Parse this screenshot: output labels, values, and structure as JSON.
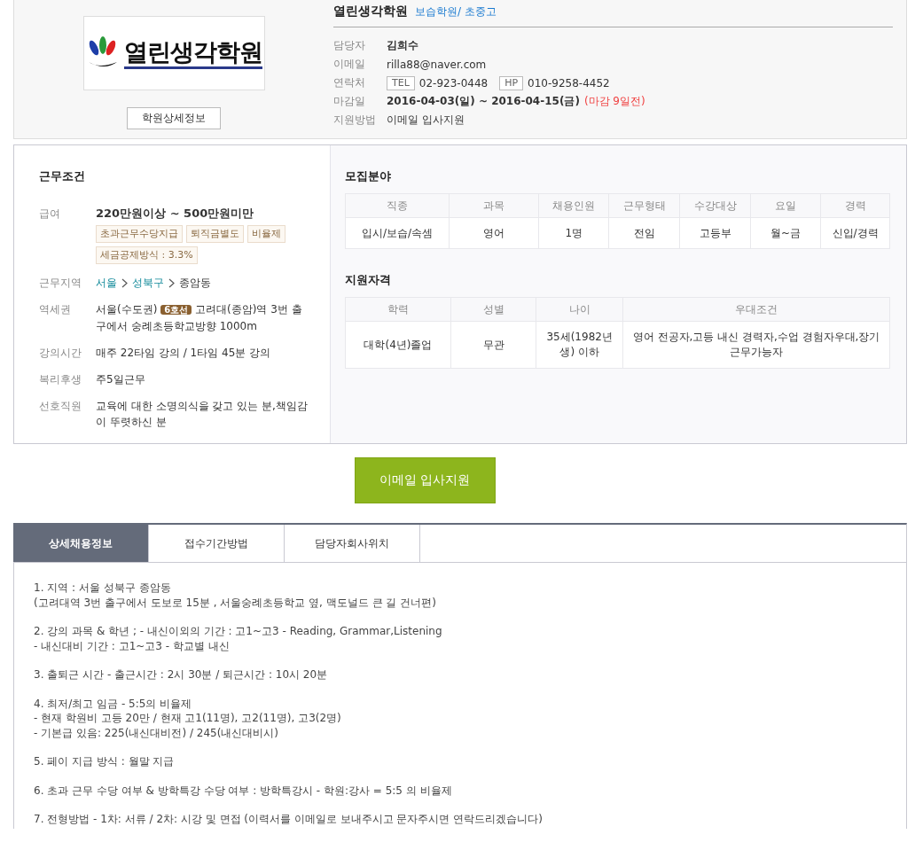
{
  "academy": {
    "logo_text": "열린생각학원",
    "detail_button": "학원상세정보",
    "name": "열린생각학원",
    "category": "보습학원/ 초중고"
  },
  "contact_rows": [
    {
      "label": "담당자",
      "kind": "bold",
      "value": "김희수"
    },
    {
      "label": "이메일",
      "kind": "plain",
      "value": "rilla88@naver.com"
    },
    {
      "label": "연락처",
      "kind": "phones",
      "phones": [
        {
          "tag": "TEL",
          "number": "02-923-0448"
        },
        {
          "tag": "HP",
          "number": "010-9258-4452"
        }
      ]
    },
    {
      "label": "마감일",
      "kind": "deadline",
      "value": "2016-04-03(일) ~ 2016-04-15(금)",
      "note": "(마감 9일전)"
    },
    {
      "label": "지원방법",
      "kind": "plain",
      "value": "이메일 입사지원"
    }
  ],
  "conditions": {
    "title": "근무조건",
    "rows": [
      {
        "label": "급여",
        "kind": "salary",
        "value": "220만원이상 ~ 500만원미만",
        "tags": [
          "초과근무수당지급",
          "퇴직금별도",
          "비율제",
          "세금공제방식 : 3.3%"
        ]
      },
      {
        "label": "근무지역",
        "kind": "location",
        "parts": [
          {
            "text": "서울",
            "link": true
          },
          {
            "text": "성북구",
            "link": true
          },
          {
            "text": "종암동",
            "link": false
          }
        ]
      },
      {
        "label": "역세권",
        "kind": "station",
        "region": "서울(수도권)",
        "line": "6호선",
        "text": "고려대(종암)역 3번 출구에서 숭례초등학교방향 1000m"
      },
      {
        "label": "강의시간",
        "kind": "plain",
        "value": "매주 22타임 강의 / 1타임 45분 강의"
      },
      {
        "label": "복리후생",
        "kind": "plain",
        "value": "주5일근무"
      },
      {
        "label": "선호직원",
        "kind": "plain",
        "value": "교육에 대한 소명의식을 갖고 있는 분,책임감이 뚜렷하신 분"
      }
    ]
  },
  "recruitment": {
    "title": "모집분야",
    "columns": [
      "직종",
      "과목",
      "채용인원",
      "근무형태",
      "수강대상",
      "요일",
      "경력"
    ],
    "rows": [
      [
        "입시/보습/속셈",
        "영어",
        "1명",
        "전임",
        "고등부",
        "월~금",
        "신입/경력"
      ]
    ]
  },
  "qualification": {
    "title": "지원자격",
    "columns": [
      "학력",
      "성별",
      "나이",
      "우대조건"
    ],
    "rows": [
      [
        "대학(4년)졸업",
        "무관",
        "35세(1982년생) 이하",
        "영어 전공자,고등 내신 경력자,수업 경험자우대,장기 근무가능자"
      ]
    ]
  },
  "apply_button": "이메일 입사지원",
  "tabs": [
    {
      "label": "상세채용정보",
      "selected": true
    },
    {
      "label": "접수기간방법",
      "selected": false
    },
    {
      "label": "담당자회사위치",
      "selected": false
    }
  ],
  "detail_paragraphs": [
    "1. 지역 : 서울 성북구 종암동\n(고려대역 3번 출구에서 도보로 15분 , 서울숭례초등학교 옆, 맥도널드 큰 길 건너편)",
    "2. 강의 과목 & 학년 ; - 내신이외의 기간 : 고1~고3 - Reading, Grammar,Listening\n- 내신대비 기간 : 고1~고3 - 학교별 내신",
    "3. 출퇴근 시간 - 출근시간 : 2시 30분 / 퇴근시간 : 10시 20분",
    "4. 최저/최고 임금 - 5:5의 비율제\n- 현재 학원비 고등 20만 / 현재 고1(11명), 고2(11명), 고3(2명)\n- 기본급 있음: 225(내신대비전) / 245(내신대비시)",
    "5. 페이 지급 방식 : 월말 지급",
    "6. 초과 근무 수당 여부 & 방학특강 수당 여부 : 방학특강시 - 학원:강사 = 5:5 의 비율제",
    "7. 전형방법 - 1차: 서류 / 2차: 시강 및 면접 (이력서를 이메일로 보내주시고 문자주시면 연락드리겠습니다)"
  ]
}
